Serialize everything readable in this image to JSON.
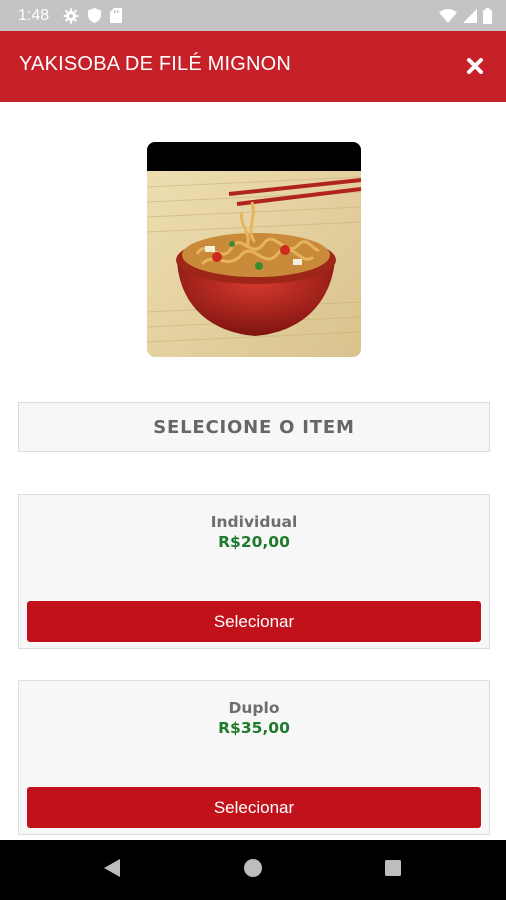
{
  "status_bar": {
    "time": "1:48",
    "icons": [
      "settings-gear-icon",
      "shield-icon",
      "sd-card-icon",
      "wifi-icon",
      "signal-icon",
      "battery-icon"
    ]
  },
  "header": {
    "title": "YAKISOBA DE FILÉ MIGNON",
    "close_icon": "close-icon",
    "background": "#c62028"
  },
  "product": {
    "image": "noodle-bowl-photo"
  },
  "select_header": {
    "label": "SELECIONE O ITEM"
  },
  "options": [
    {
      "name": "Individual",
      "price": "R$20,00",
      "button_label": "Selecionar"
    },
    {
      "name": "Duplo",
      "price": "R$35,00",
      "button_label": "Selecionar"
    }
  ],
  "colors": {
    "accent": "#c1121c",
    "price": "#1e7b2c"
  },
  "nav_bar": {
    "icons": [
      "back-icon",
      "home-icon",
      "recents-icon"
    ]
  }
}
